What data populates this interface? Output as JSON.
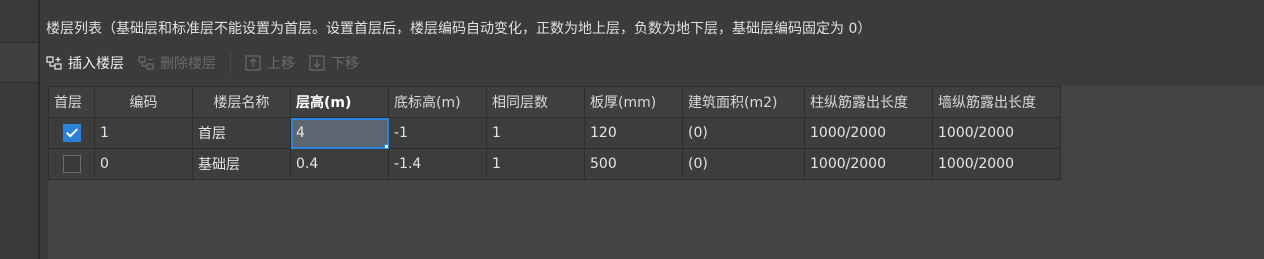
{
  "header": {
    "title": "楼层列表（基础层和标准层不能设置为首层。设置首层后，楼层编码自动变化，正数为地上层，负数为地下层，基础层编码固定为 0）"
  },
  "toolbar": {
    "insert_label": "插入楼层",
    "delete_label": "删除楼层",
    "up_label": "上移",
    "down_label": "下移"
  },
  "table": {
    "columns": [
      "首层",
      "编码",
      "楼层名称",
      "层高(m)",
      "底标高(m)",
      "相同层数",
      "板厚(mm)",
      "建筑面积(m2)",
      "柱纵筋露出长度",
      "墙纵筋露出长度"
    ],
    "rows": [
      {
        "first_floor": true,
        "code": "1",
        "name": "首层",
        "height": "4",
        "bottom_elev": "-1",
        "same_count": "1",
        "slab": "120",
        "area": "(0)",
        "col_rebar": "1000/2000",
        "wall_rebar": "1000/2000"
      },
      {
        "first_floor": false,
        "code": "0",
        "name": "基础层",
        "height": "0.4",
        "bottom_elev": "-1.4",
        "same_count": "1",
        "slab": "500",
        "area": "(0)",
        "col_rebar": "1000/2000",
        "wall_rebar": "1000/2000"
      }
    ]
  },
  "colors": {
    "accent": "#2a82da",
    "background": "#3b3b3b"
  }
}
